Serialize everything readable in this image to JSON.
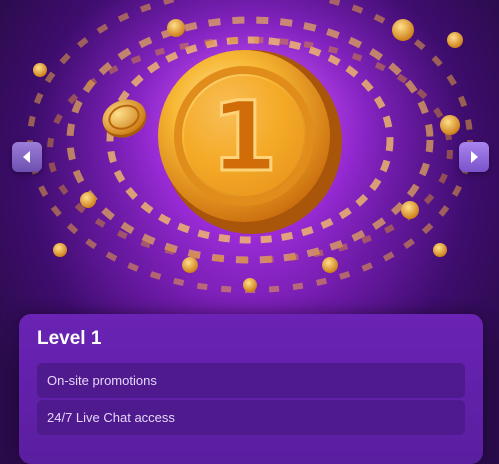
{
  "carousel": {
    "prev_icon": "chevron-left-icon",
    "next_icon": "chevron-right-icon",
    "coin_number": "1"
  },
  "level_card": {
    "title": "Level 1",
    "perks": [
      {
        "label": "On-site promotions"
      },
      {
        "label": "24/7 Live Chat access"
      }
    ]
  },
  "colors": {
    "background": "#2a0b4a",
    "glow": "#d24dff",
    "card": "#6a23b4",
    "perk_row": "#4e1a8e",
    "coin_gold": "#f7a21b"
  }
}
